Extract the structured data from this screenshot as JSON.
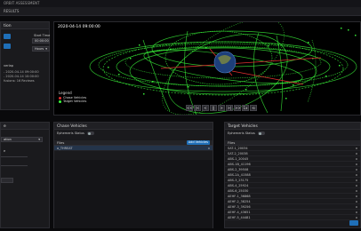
{
  "app": {
    "title": "ORBIT ASSESSMENT",
    "subtitle": "RESULTS"
  },
  "left_panel": {
    "title": "tion",
    "start_time_label": "Start Time",
    "start_time_value": "00:00:00",
    "step_label": "Hours",
    "overlap_title": "verlap",
    "overlap_lines": [
      "- 2020-04-14 09:00:00",
      "- 2020-04-14 10:00:00",
      "fusions: 16 Reviews"
    ]
  },
  "viewport": {
    "timestamp": "2020-04-14 09:00:00",
    "legend_title": "Legend",
    "legend_items": [
      "Chase Vehicles",
      "Target Vehicles"
    ],
    "colors": {
      "chase": "#e03030",
      "target": "#3cff3c"
    },
    "controls": [
      "<<",
      "|<",
      "<",
      "||",
      ">",
      ">|",
      ">>",
      "1x",
      "⟲"
    ]
  },
  "bottom_left": {
    "title": "e",
    "select_value": "ation",
    "field_label": "e"
  },
  "chase": {
    "title": "Chase Vehicles",
    "ephemeris_label": "Ephemeris Status",
    "files_label": "Files",
    "add_button": "Add Vehicles",
    "rows": [
      {
        "name": "o_THREAT",
        "x": "x"
      }
    ]
  },
  "target": {
    "title": "Target Vehicles",
    "ephemeris_label": "Ephemeris Status",
    "files_label": "Files",
    "rows": [
      "SAT-1_20034",
      "SAT-2_20038",
      "ABS-1_20045",
      "ABS-1B_41196",
      "ABS-2_39508",
      "ABS-2A_41588",
      "ABS-3_23175",
      "ABS-4_25924",
      "ABS-6_25030",
      "AEHF-1_36868",
      "AEHF-2_38254",
      "AEHF-3_39256",
      "AEHF-4_43651",
      "AEHF-5_44481"
    ]
  }
}
